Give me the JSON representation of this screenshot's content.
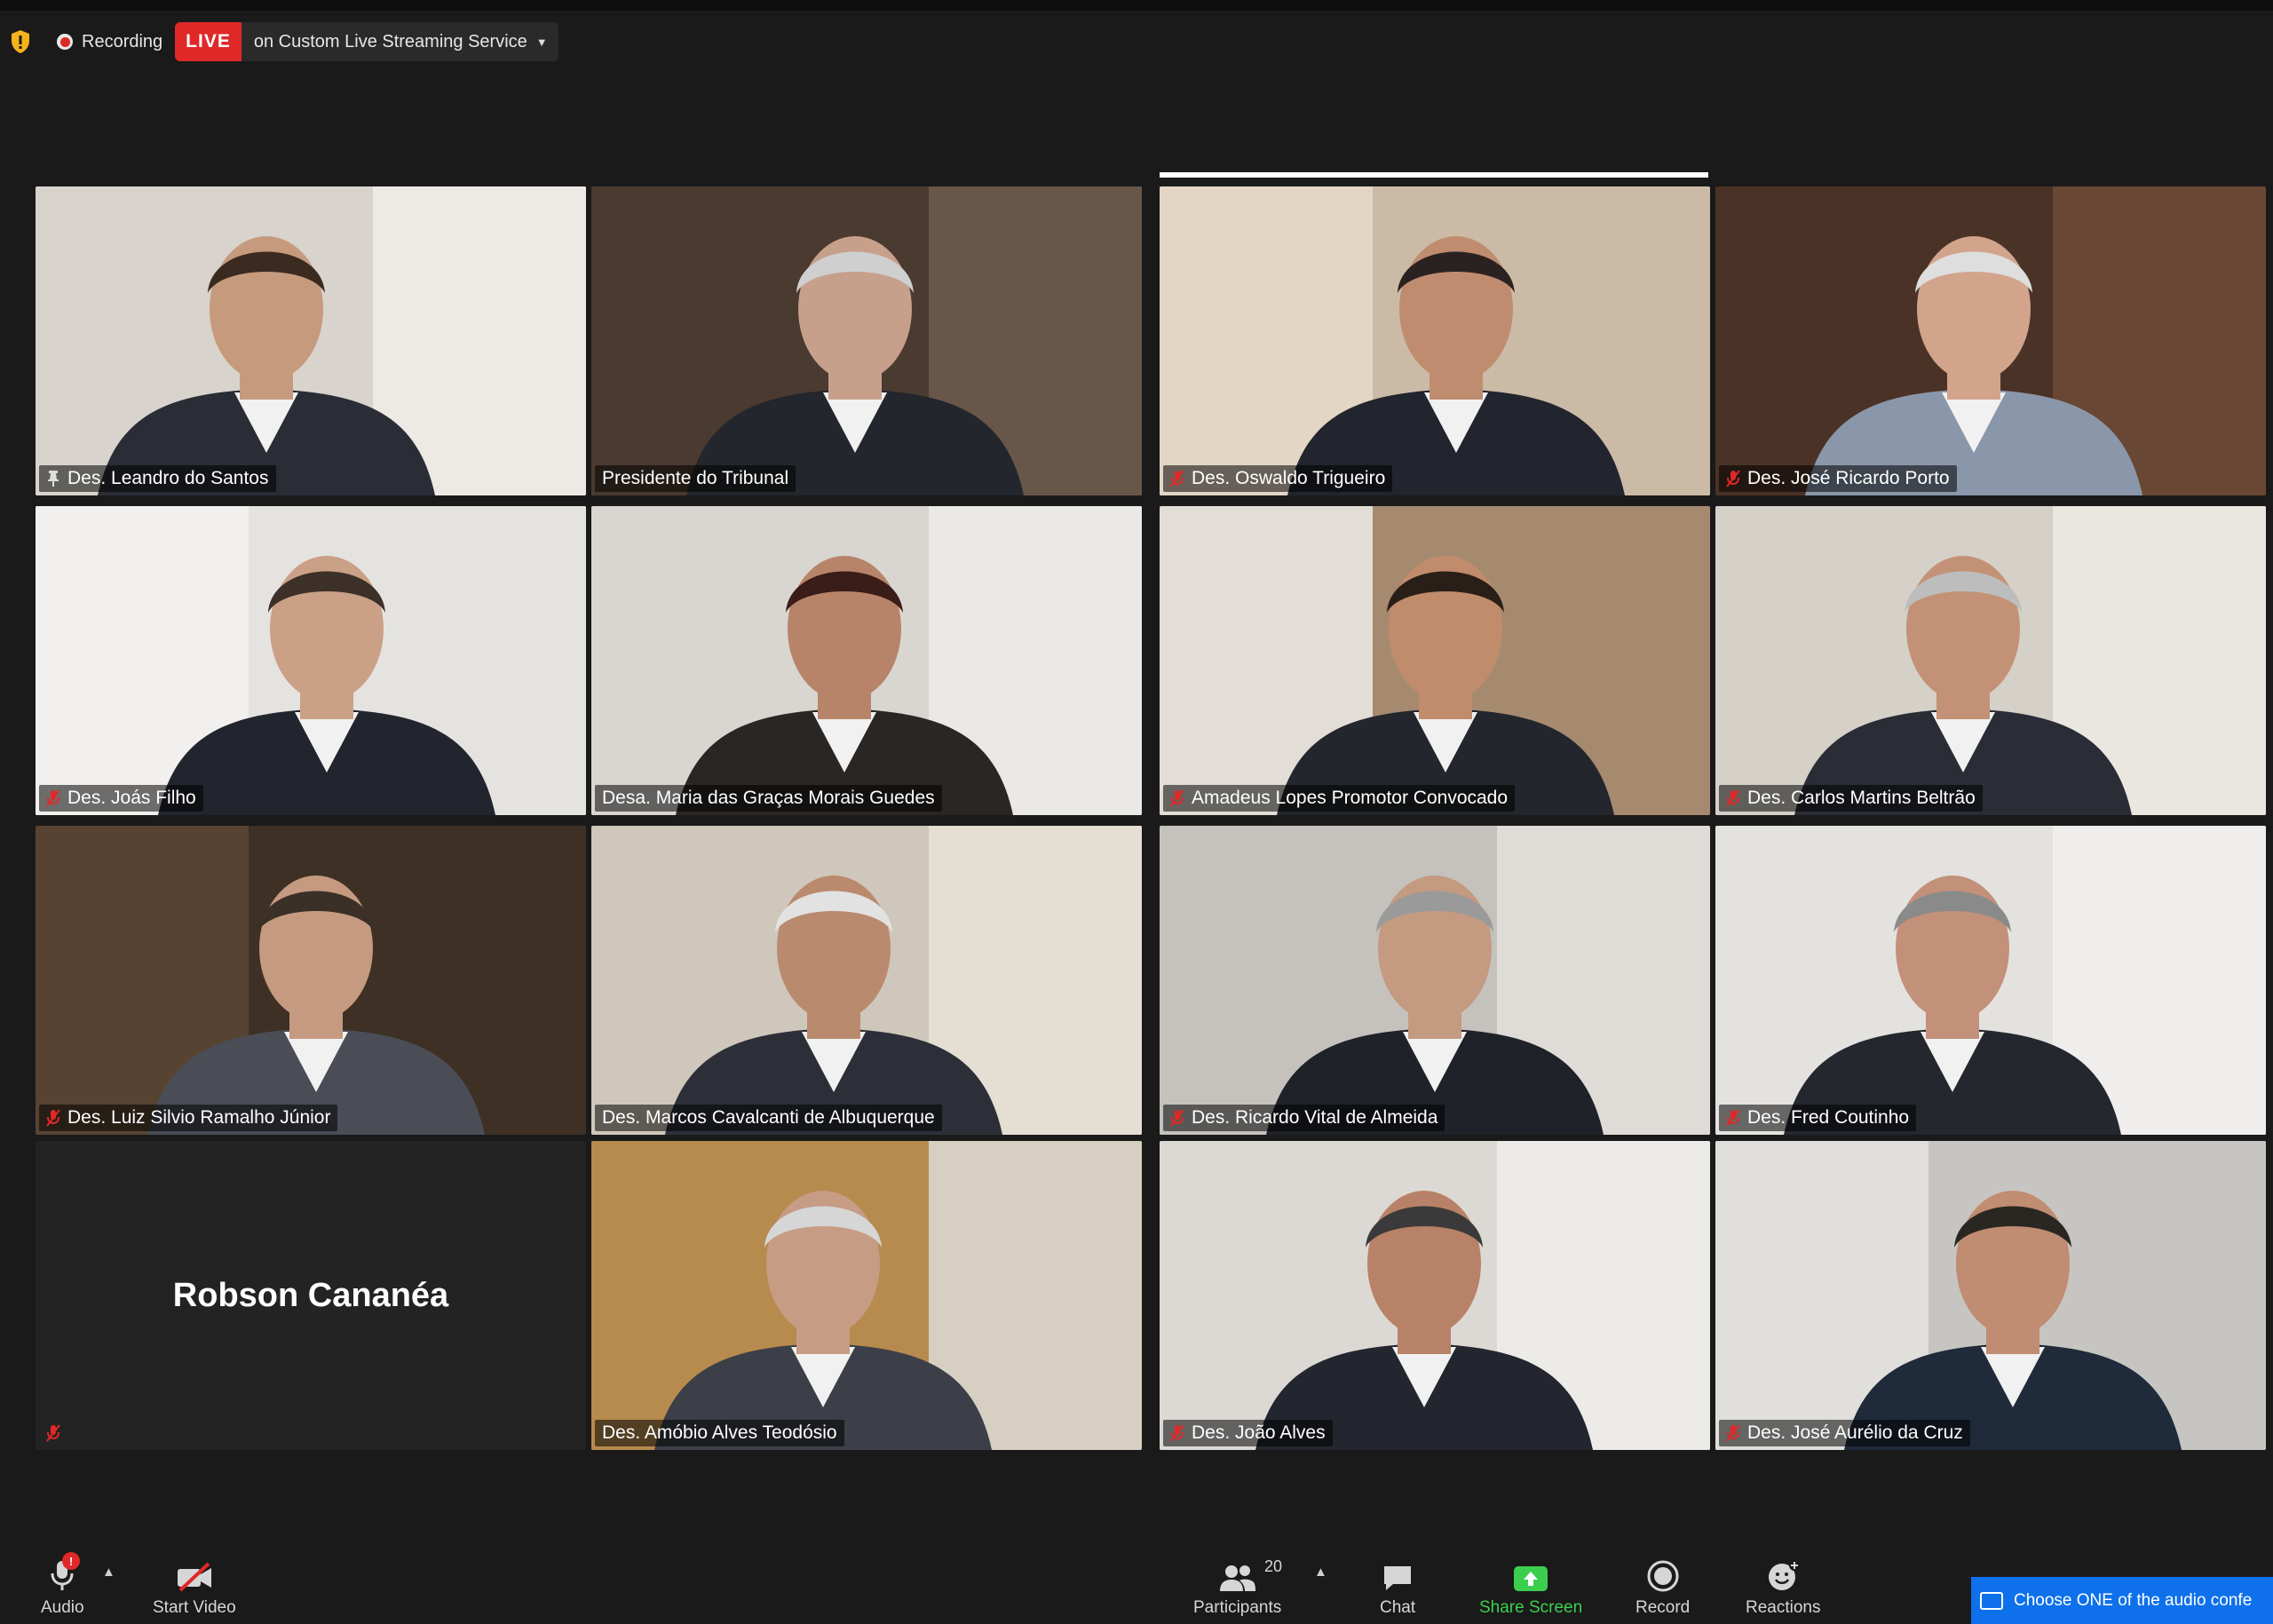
{
  "status": {
    "recording_label": "Recording",
    "live_badge": "LIVE",
    "live_text": "on Custom Live Streaming Service"
  },
  "participants": [
    {
      "name": "Des. Leandro do Santos",
      "bg": "#d8d3cc",
      "wall": "#efece8",
      "suit": "#2a2d36",
      "skin": "#c69a7c",
      "hair": "#3a2a20",
      "mic": "pin"
    },
    {
      "name": "Presidente do Tribunal",
      "bg": "#4a3a30",
      "wall": "#6b5a4c",
      "suit": "#23262c",
      "skin": "#c7a08c",
      "hair": "#cfcfcf",
      "mic": "none"
    },
    {
      "name": "Des. Oswaldo Trigueiro",
      "bg": "#cbbba6",
      "wall": "#e5d9c9",
      "suit": "#22252e",
      "skin": "#c08c70",
      "hair": "#2a2220",
      "mic": "muted"
    },
    {
      "name": "Des. José Ricardo Porto",
      "bg": "#4a3226",
      "wall": "#6b4a36",
      "suit": "#8a97aa",
      "skin": "#d2a48c",
      "hair": "#dedede",
      "mic": "muted"
    },
    {
      "name": "Des. Joás Filho",
      "bg": "#e5e3e0",
      "wall": "#f2f1ef",
      "suit": "#22252e",
      "skin": "#caa086",
      "hair": "#3c3028",
      "mic": "muted"
    },
    {
      "name": "Desa. Maria das Graças Morais Guedes",
      "bg": "#d9d6d1",
      "wall": "#ecebe8",
      "suit": "#2a2624",
      "skin": "#b7846a",
      "hair": "#3a1d18",
      "mic": "none"
    },
    {
      "name": "Amadeus Lopes Promotor Convocado",
      "bg": "#a68a70",
      "wall": "#e9e6e1",
      "suit": "#23262c",
      "skin": "#c08c6c",
      "hair": "#2a1f18",
      "mic": "muted"
    },
    {
      "name": "Des. Carlos Martins Beltrão",
      "bg": "#d5d0c8",
      "wall": "#ece8e2",
      "suit": "#2a2d36",
      "skin": "#c39276",
      "hair": "#bdbdbd",
      "mic": "muted"
    },
    {
      "name": "Des. Luiz Silvio Ramalho Júnior",
      "bg": "#3e3024",
      "wall": "#5a4634",
      "suit": "#4a4d56",
      "skin": "#c59a80",
      "hair": "#3a3028",
      "mic": "muted"
    },
    {
      "name": "Des. Marcos Cavalcanti de Albuquerque",
      "bg": "#cfc7bb",
      "wall": "#e6e0d6",
      "suit": "#2c2f38",
      "skin": "#b98a6e",
      "hair": "#e2e2e2",
      "mic": "none"
    },
    {
      "name": "Des. Ricardo Vital de Almeida",
      "bg": "#c5c2bd",
      "wall": "#e1ded9",
      "suit": "#1f2228",
      "skin": "#c49a80",
      "hair": "#9a9a9a",
      "mic": "muted"
    },
    {
      "name": "Des. Fred Coutinho",
      "bg": "#e4e2df",
      "wall": "#f0efed",
      "suit": "#24272e",
      "skin": "#c3907a",
      "hair": "#8a8a8a",
      "mic": "muted"
    },
    {
      "name": "Robson Cananéa",
      "bg": "#232323",
      "mic": "muted",
      "video_off": true
    },
    {
      "name": "Des. Amóbio Alves Teodósio",
      "bg": "#b78a4e",
      "wall": "#d9d6cf",
      "suit": "#3c3f48",
      "skin": "#c79c84",
      "hair": "#d6d6d6",
      "mic": "none"
    },
    {
      "name": "Des. João Alves",
      "bg": "#dcd9d4",
      "wall": "#eeece9",
      "suit": "#23262e",
      "skin": "#b88268",
      "hair": "#3a3a3a",
      "mic": "muted"
    },
    {
      "name": "Des. José Aurélio da Cruz",
      "bg": "#c7c5c1",
      "wall": "#e2e1de",
      "suit": "#1f2a3a",
      "skin": "#c08c72",
      "hair": "#2a2622",
      "mic": "muted"
    }
  ],
  "toolbar": {
    "audio_label": "Audio",
    "audio_badge": "!",
    "video_label": "Start Video",
    "participants_label": "Participants",
    "participants_count": "20",
    "chat_label": "Chat",
    "share_label": "Share Screen",
    "record_label": "Record",
    "reactions_label": "Reactions",
    "share_color": "#3ccf4e"
  },
  "notice": {
    "text": "Choose ONE of the audio confe"
  }
}
